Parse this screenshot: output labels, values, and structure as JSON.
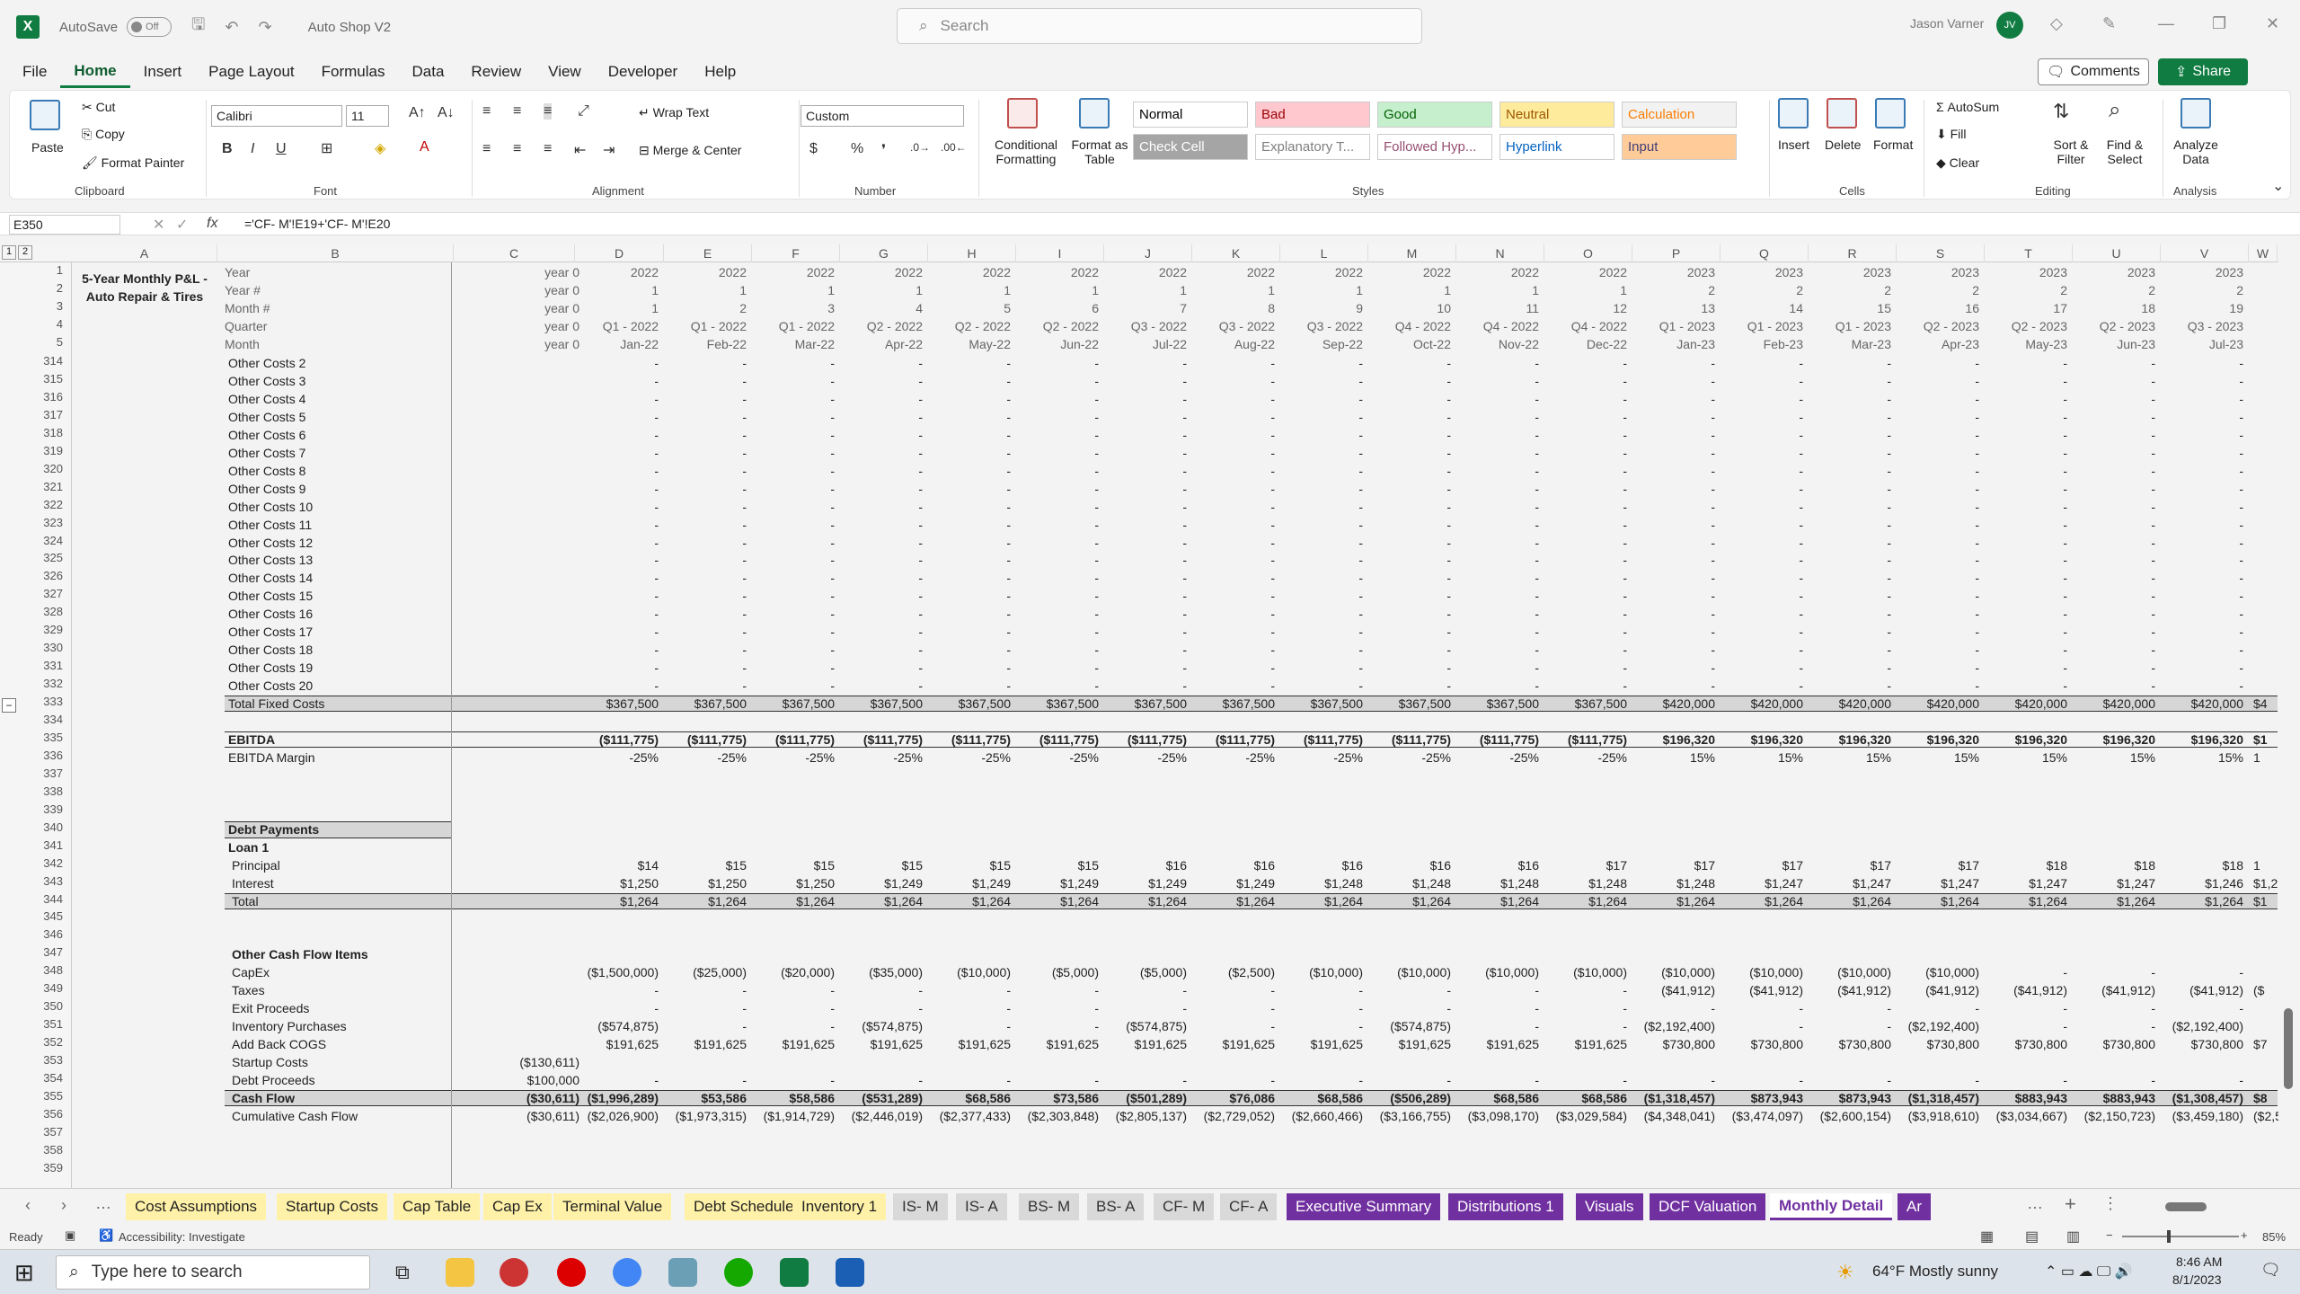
{
  "titlebar": {
    "autosave": "AutoSave",
    "toggle": "Off",
    "filename": "Auto Shop V2",
    "search": "Search",
    "user": "Jason Varner",
    "initials": "JV"
  },
  "menu": [
    "File",
    "Home",
    "Insert",
    "Page Layout",
    "Formulas",
    "Data",
    "Review",
    "View",
    "Developer",
    "Help"
  ],
  "comments": "Comments",
  "share": "Share",
  "ribbon": {
    "clipboard": {
      "label": "Clipboard",
      "paste": "Paste",
      "cut": "Cut",
      "copy": "Copy",
      "format_painter": "Format Painter"
    },
    "font": {
      "label": "Font",
      "name": "Calibri",
      "size": "11"
    },
    "alignment": {
      "label": "Alignment",
      "wrap": "Wrap Text",
      "merge": "Merge & Center"
    },
    "number": {
      "label": "Number",
      "format": "Custom"
    },
    "styles": {
      "label": "Styles",
      "cond1": "Conditional",
      "cond2": "Formatting",
      "fmt1": "Format as",
      "fmt2": "Table",
      "cells": [
        {
          "t": "Normal",
          "bg": "#ffffff",
          "c": "#000000"
        },
        {
          "t": "Bad",
          "bg": "#ffc7ce",
          "c": "#9c0006"
        },
        {
          "t": "Good",
          "bg": "#c6efce",
          "c": "#006100"
        },
        {
          "t": "Neutral",
          "bg": "#ffeb9c",
          "c": "#9c5700"
        },
        {
          "t": "Calculation",
          "bg": "#f2f2f2",
          "c": "#fa7d00"
        },
        {
          "t": "Check Cell",
          "bg": "#a5a5a5",
          "c": "#ffffff"
        },
        {
          "t": "Explanatory T...",
          "bg": "#ffffff",
          "c": "#7f7f7f"
        },
        {
          "t": "Followed Hyp...",
          "bg": "#ffffff",
          "c": "#954f72"
        },
        {
          "t": "Hyperlink",
          "bg": "#ffffff",
          "c": "#0563c1"
        },
        {
          "t": "Input",
          "bg": "#ffcc99",
          "c": "#3f3f76"
        }
      ]
    },
    "cells": {
      "label": "Cells",
      "insert": "Insert",
      "delete": "Delete",
      "format": "Format"
    },
    "editing": {
      "label": "Editing",
      "autosum": "AutoSum",
      "fill": "Fill",
      "clear": "Clear",
      "sort1": "Sort &",
      "sort2": "Filter",
      "find1": "Find &",
      "find2": "Select"
    },
    "analysis": {
      "label": "Analysis",
      "a1": "Analyze",
      "a2": "Data"
    }
  },
  "formula": {
    "name": "E350",
    "fx": "fx",
    "text": "='CF- M'!E19+'CF- M'!E20"
  },
  "outline": [
    "1",
    "2"
  ],
  "columns": [
    "A",
    "B",
    "C",
    "D",
    "E",
    "F",
    "G",
    "H",
    "I",
    "J",
    "K",
    "L",
    "M",
    "N",
    "O",
    "P",
    "Q",
    "R",
    "S",
    "T",
    "U",
    "V",
    "W"
  ],
  "title_line1": "5-Year Monthly P&L -",
  "title_line2": "Auto Repair & Tires",
  "header_rows": [
    {
      "n": "1",
      "label": "Year",
      "c": "year 0",
      "v": [
        "2022",
        "2022",
        "2022",
        "2022",
        "2022",
        "2022",
        "2022",
        "2022",
        "2022",
        "2022",
        "2022",
        "2022",
        "2023",
        "2023",
        "2023",
        "2023",
        "2023",
        "2023",
        "2023"
      ]
    },
    {
      "n": "2",
      "label": "Year #",
      "c": "year 0",
      "v": [
        "1",
        "1",
        "1",
        "1",
        "1",
        "1",
        "1",
        "1",
        "1",
        "1",
        "1",
        "1",
        "2",
        "2",
        "2",
        "2",
        "2",
        "2",
        "2"
      ]
    },
    {
      "n": "3",
      "label": "Month #",
      "c": "year 0",
      "v": [
        "1",
        "2",
        "3",
        "4",
        "5",
        "6",
        "7",
        "8",
        "9",
        "10",
        "11",
        "12",
        "13",
        "14",
        "15",
        "16",
        "17",
        "18",
        "19"
      ]
    },
    {
      "n": "4",
      "label": "Quarter",
      "c": "year 0",
      "v": [
        "Q1 - 2022",
        "Q1 - 2022",
        "Q1 - 2022",
        "Q2 - 2022",
        "Q2 - 2022",
        "Q2 - 2022",
        "Q3 - 2022",
        "Q3 - 2022",
        "Q3 - 2022",
        "Q4 - 2022",
        "Q4 - 2022",
        "Q4 - 2022",
        "Q1 - 2023",
        "Q1 - 2023",
        "Q1 - 2023",
        "Q2 - 2023",
        "Q2 - 2023",
        "Q2 - 2023",
        "Q3 - 2023"
      ]
    },
    {
      "n": "5",
      "label": "Month",
      "c": "year 0",
      "v": [
        "Jan-22",
        "Feb-22",
        "Mar-22",
        "Apr-22",
        "May-22",
        "Jun-22",
        "Jul-22",
        "Aug-22",
        "Sep-22",
        "Oct-22",
        "Nov-22",
        "Dec-22",
        "Jan-23",
        "Feb-23",
        "Mar-23",
        "Apr-23",
        "May-23",
        "Jun-23",
        "Jul-23"
      ]
    }
  ],
  "rows": [
    {
      "n": "314",
      "label": "Other Costs 2",
      "dash": true
    },
    {
      "n": "315",
      "label": "Other Costs 3",
      "dash": true
    },
    {
      "n": "316",
      "label": "Other Costs 4",
      "dash": true
    },
    {
      "n": "317",
      "label": "Other Costs 5",
      "dash": true
    },
    {
      "n": "318",
      "label": "Other Costs 6",
      "dash": true
    },
    {
      "n": "319",
      "label": "Other Costs 7",
      "dash": true
    },
    {
      "n": "320",
      "label": "Other Costs 8",
      "dash": true
    },
    {
      "n": "321",
      "label": "Other Costs 9",
      "dash": true
    },
    {
      "n": "322",
      "label": "Other Costs 10",
      "dash": true
    },
    {
      "n": "323",
      "label": "Other Costs 11",
      "dash": true
    },
    {
      "n": "324",
      "label": "Other Costs 12",
      "dash": true
    },
    {
      "n": "325",
      "label": "Other Costs 13",
      "dash": true
    },
    {
      "n": "326",
      "label": "Other Costs 14",
      "dash": true
    },
    {
      "n": "327",
      "label": "Other Costs 15",
      "dash": true
    },
    {
      "n": "328",
      "label": "Other Costs 16",
      "dash": true
    },
    {
      "n": "329",
      "label": "Other Costs 17",
      "dash": true
    },
    {
      "n": "330",
      "label": "Other Costs 18",
      "dash": true
    },
    {
      "n": "331",
      "label": "Other Costs 19",
      "dash": true
    },
    {
      "n": "332",
      "label": "Other Costs 20",
      "dash": true
    },
    {
      "n": "333",
      "label": "Total Fixed Costs",
      "band": true,
      "v": [
        "$367,500",
        "$367,500",
        "$367,500",
        "$367,500",
        "$367,500",
        "$367,500",
        "$367,500",
        "$367,500",
        "$367,500",
        "$367,500",
        "$367,500",
        "$367,500",
        "$420,000",
        "$420,000",
        "$420,000",
        "$420,000",
        "$420,000",
        "$420,000",
        "$420,000"
      ]
    },
    {
      "n": "334",
      "label": ""
    },
    {
      "n": "335",
      "label": "EBITDA",
      "bold": true,
      "box": true,
      "v": [
        "($111,775)",
        "($111,775)",
        "($111,775)",
        "($111,775)",
        "($111,775)",
        "($111,775)",
        "($111,775)",
        "($111,775)",
        "($111,775)",
        "($111,775)",
        "($111,775)",
        "($111,775)",
        "$196,320",
        "$196,320",
        "$196,320",
        "$196,320",
        "$196,320",
        "$196,320",
        "$196,320"
      ]
    },
    {
      "n": "336",
      "label": "EBITDA Margin",
      "v": [
        "-25%",
        "-25%",
        "-25%",
        "-25%",
        "-25%",
        "-25%",
        "-25%",
        "-25%",
        "-25%",
        "-25%",
        "-25%",
        "-25%",
        "15%",
        "15%",
        "15%",
        "15%",
        "15%",
        "15%",
        "15%"
      ]
    },
    {
      "n": "337",
      "label": ""
    },
    {
      "n": "338",
      "label": ""
    },
    {
      "n": "339",
      "label": ""
    },
    {
      "n": "340",
      "label": "Debt Payments",
      "bold": true,
      "shade": true
    },
    {
      "n": "341",
      "label": "Loan 1",
      "bold": true
    },
    {
      "n": "342",
      "label": "Principal",
      "indent": true,
      "v": [
        "$14",
        "$15",
        "$15",
        "$15",
        "$15",
        "$15",
        "$16",
        "$16",
        "$16",
        "$16",
        "$16",
        "$17",
        "$17",
        "$17",
        "$17",
        "$17",
        "$18",
        "$18",
        "$18"
      ]
    },
    {
      "n": "343",
      "label": "Interest",
      "indent": true,
      "v": [
        "$1,250",
        "$1,250",
        "$1,250",
        "$1,249",
        "$1,249",
        "$1,249",
        "$1,249",
        "$1,249",
        "$1,248",
        "$1,248",
        "$1,248",
        "$1,248",
        "$1,248",
        "$1,247",
        "$1,247",
        "$1,247",
        "$1,247",
        "$1,247",
        "$1,246"
      ]
    },
    {
      "n": "344",
      "label": "Total",
      "band": true,
      "indent": true,
      "v": [
        "$1,264",
        "$1,264",
        "$1,264",
        "$1,264",
        "$1,264",
        "$1,264",
        "$1,264",
        "$1,264",
        "$1,264",
        "$1,264",
        "$1,264",
        "$1,264",
        "$1,264",
        "$1,264",
        "$1,264",
        "$1,264",
        "$1,264",
        "$1,264",
        "$1,264"
      ]
    },
    {
      "n": "345",
      "label": ""
    },
    {
      "n": "346",
      "label": ""
    },
    {
      "n": "347",
      "label": "Other Cash Flow Items",
      "bold": true,
      "indent": true
    },
    {
      "n": "348",
      "label": "CapEx",
      "indent": true,
      "v": [
        "($1,500,000)",
        "($25,000)",
        "($20,000)",
        "($35,000)",
        "($10,000)",
        "($5,000)",
        "($5,000)",
        "($2,500)",
        "($10,000)",
        "($10,000)",
        "($10,000)",
        "($10,000)",
        "($10,000)",
        "($10,000)",
        "($10,000)",
        "($10,000)",
        "-",
        "-",
        "-"
      ]
    },
    {
      "n": "349",
      "label": "Taxes",
      "indent": true,
      "v": [
        "-",
        "-",
        "-",
        "-",
        "-",
        "-",
        "-",
        "-",
        "-",
        "-",
        "-",
        "-",
        "($41,912)",
        "($41,912)",
        "($41,912)",
        "($41,912)",
        "($41,912)",
        "($41,912)",
        "($41,912)"
      ]
    },
    {
      "n": "350",
      "label": "Exit Proceeds",
      "indent": true,
      "v": [
        "-",
        "-",
        "-",
        "-",
        "-",
        "-",
        "-",
        "-",
        "-",
        "-",
        "-",
        "-",
        "-",
        "-",
        "-",
        "-",
        "-",
        "-",
        "-"
      ]
    },
    {
      "n": "351",
      "label": "Inventory Purchases",
      "indent": true,
      "v": [
        "($574,875)",
        "-",
        "-",
        "($574,875)",
        "-",
        "-",
        "($574,875)",
        "-",
        "-",
        "($574,875)",
        "-",
        "-",
        "($2,192,400)",
        "-",
        "-",
        "($2,192,400)",
        "-",
        "-",
        "($2,192,400)"
      ]
    },
    {
      "n": "352",
      "label": "Add Back COGS",
      "indent": true,
      "v": [
        "$191,625",
        "$191,625",
        "$191,625",
        "$191,625",
        "$191,625",
        "$191,625",
        "$191,625",
        "$191,625",
        "$191,625",
        "$191,625",
        "$191,625",
        "$191,625",
        "$730,800",
        "$730,800",
        "$730,800",
        "$730,800",
        "$730,800",
        "$730,800",
        "$730,800"
      ]
    },
    {
      "n": "353",
      "label": "Startup Costs",
      "indent": true,
      "c": "($130,611)"
    },
    {
      "n": "354",
      "label": "Debt Proceeds",
      "indent": true,
      "c": "$100,000",
      "v": [
        "-",
        "-",
        "-",
        "-",
        "-",
        "-",
        "-",
        "-",
        "-",
        "-",
        "-",
        "-",
        "-",
        "-",
        "-",
        "-",
        "-",
        "-",
        "-"
      ]
    },
    {
      "n": "355",
      "label": "Cash Flow",
      "bold": true,
      "band": true,
      "indent": true,
      "c": "($30,611)",
      "v": [
        "($1,996,289)",
        "$53,586",
        "$58,586",
        "($531,289)",
        "$68,586",
        "$73,586",
        "($501,289)",
        "$76,086",
        "$68,586",
        "($506,289)",
        "$68,586",
        "$68,586",
        "($1,318,457)",
        "$873,943",
        "$873,943",
        "($1,318,457)",
        "$883,943",
        "$883,943",
        "($1,308,457)"
      ]
    },
    {
      "n": "356",
      "label": "Cumulative Cash Flow",
      "indent": true,
      "c": "($30,611)",
      "v": [
        "($2,026,900)",
        "($1,973,315)",
        "($1,914,729)",
        "($2,446,019)",
        "($2,377,433)",
        "($2,303,848)",
        "($2,805,137)",
        "($2,729,052)",
        "($2,660,466)",
        "($3,166,755)",
        "($3,098,170)",
        "($3,029,584)",
        "($4,348,041)",
        "($3,474,097)",
        "($2,600,154)",
        "($3,918,610)",
        "($3,034,667)",
        "($2,150,723)",
        "($3,459,180)"
      ]
    },
    {
      "n": "357",
      "label": ""
    },
    {
      "n": "358",
      "label": ""
    },
    {
      "n": "359",
      "label": ""
    }
  ],
  "partial_col": {
    "333": "$4",
    "335": "$1",
    "344": "$1",
    "349": "($",
    "355": "$8",
    "356": "($2,5",
    "336": "1",
    "342": "1",
    "343": "$1,2",
    "352": "$7"
  },
  "tabs": [
    {
      "t": "Cost Assumptions",
      "bg": "#fff2a8",
      "c": "#222"
    },
    {
      "t": "Startup Costs",
      "bg": "#fff2a8",
      "c": "#222"
    },
    {
      "t": "Cap Table",
      "bg": "#fff2a8",
      "c": "#222"
    },
    {
      "t": "Cap Ex",
      "bg": "#fff2a8",
      "c": "#222"
    },
    {
      "t": "Terminal Value",
      "bg": "#fff2a8",
      "c": "#222"
    },
    {
      "t": "Debt Schedule",
      "bg": "#fff2a8",
      "c": "#222"
    },
    {
      "t": "Inventory 1",
      "bg": "#fff2a8",
      "c": "#222"
    },
    {
      "t": "IS- M",
      "bg": "#d9d9d9",
      "c": "#333"
    },
    {
      "t": "IS- A",
      "bg": "#d9d9d9",
      "c": "#333"
    },
    {
      "t": "BS- M",
      "bg": "#d9d9d9",
      "c": "#333"
    },
    {
      "t": "BS- A",
      "bg": "#d9d9d9",
      "c": "#333"
    },
    {
      "t": "CF- M",
      "bg": "#d9d9d9",
      "c": "#333"
    },
    {
      "t": "CF- A",
      "bg": "#d9d9d9",
      "c": "#333"
    },
    {
      "t": "Executive Summary",
      "bg": "#7030a0",
      "c": "#fff"
    },
    {
      "t": "Distributions 1",
      "bg": "#7030a0",
      "c": "#fff"
    },
    {
      "t": "Visuals",
      "bg": "#7030a0",
      "c": "#fff"
    },
    {
      "t": "DCF Valuation",
      "bg": "#7030a0",
      "c": "#fff"
    },
    {
      "t": "Monthly Detail",
      "bg": "#ffffff",
      "c": "#7030a0"
    },
    {
      "t": "Ar",
      "bg": "#7030a0",
      "c": "#fff"
    }
  ],
  "status": {
    "ready": "Ready",
    "access": "Accessibility: Investigate",
    "zoom": "85%"
  },
  "taskbar": {
    "search": "Type here to search",
    "weather": "64°F  Mostly sunny",
    "time": "8:46 AM",
    "date": "8/1/2023"
  }
}
